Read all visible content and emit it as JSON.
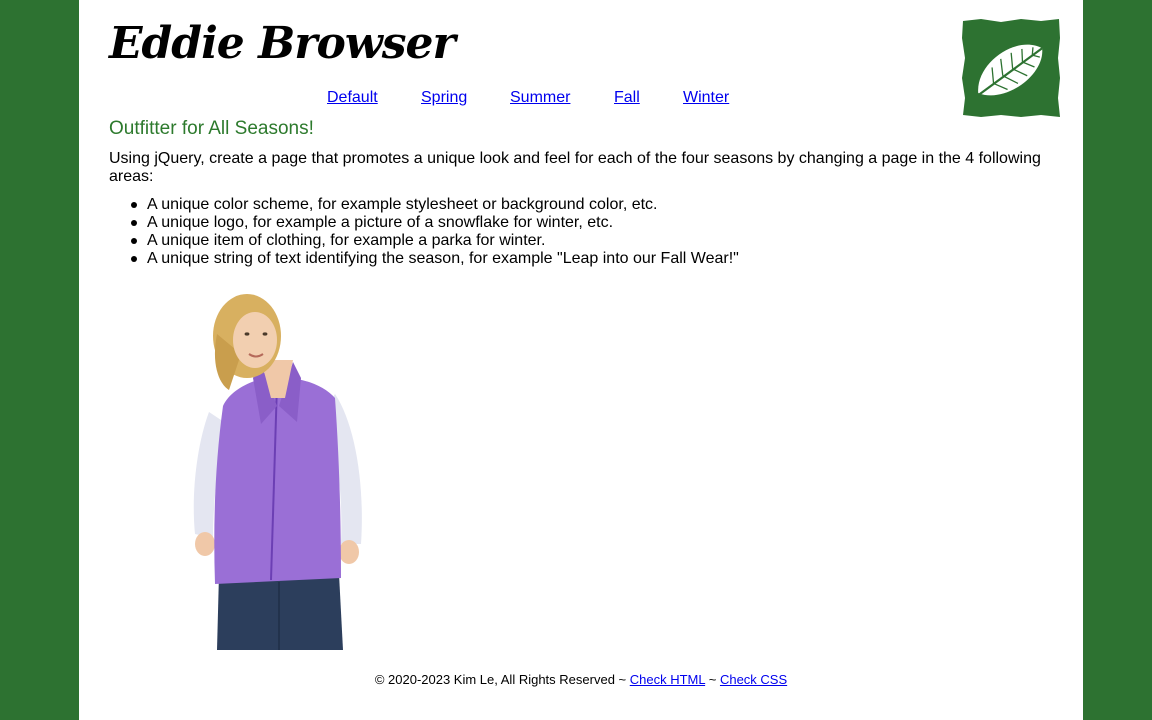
{
  "header": {
    "brand": "Eddie Browser",
    "logo_icon": "leaf-icon"
  },
  "nav": {
    "items": [
      {
        "label": "Default"
      },
      {
        "label": "Spring"
      },
      {
        "label": "Summer"
      },
      {
        "label": "Fall"
      },
      {
        "label": "Winter"
      }
    ]
  },
  "main": {
    "tagline": "Outfitter for All Seasons!",
    "intro": "Using jQuery, create a page that promotes a unique look and feel for each of the four seasons by changing a page in the 4 following areas:",
    "requirements": [
      "A unique color scheme, for example stylesheet or background color, etc.",
      "A unique logo, for example a picture of a snowflake for winter, etc.",
      "A unique item of clothing, for example a parka for winter.",
      "A unique string of text identifying the season, for example \"Leap into our Fall Wear!\""
    ],
    "product_icon": "purple-vest-model-photo"
  },
  "footer": {
    "copyright": "© 2020-2023 Kim Le, All Rights Reserved ~ ",
    "check_html": "Check HTML",
    "separator": " ~ ",
    "check_css": "Check CSS"
  },
  "colors": {
    "theme_green": "#2d7231",
    "tagline_green": "#2d7a2d",
    "link_blue": "#0000ee",
    "vest_purple": "#9a6fd6"
  }
}
